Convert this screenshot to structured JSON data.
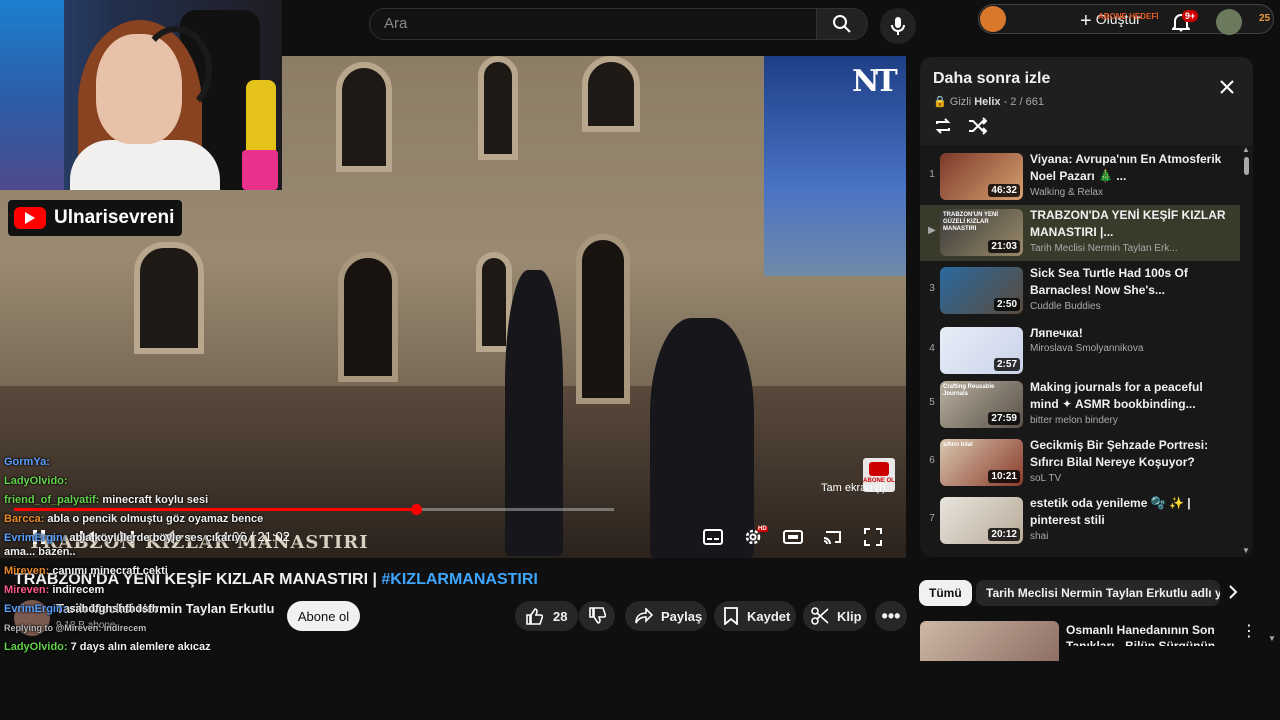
{
  "search": {
    "placeholder": "Ara"
  },
  "topbar": {
    "subscriber_goal": "ABONE HEDEFİ",
    "create_label": "Oluştur",
    "notification_count": "9+",
    "corner_number": "25"
  },
  "player": {
    "time_display": "14:06 / 21:02",
    "progress_fraction": 0.67,
    "fullscreen_tooltip": "Tam ekran (f)",
    "caption_overlay": "TRABZON KIZLAR MANASTIRI",
    "watermark": "NT",
    "abone_badge": "ABONE OL",
    "hd_badge": "HD"
  },
  "webcam": {
    "channel_name": "Ulnarisevreni"
  },
  "chat": [
    {
      "name": "GormYa:",
      "text": "",
      "color": "n-blue"
    },
    {
      "name": "LadyOlvido:",
      "text": "",
      "color": "n-green"
    },
    {
      "name": "friend_of_palyatif:",
      "text": "minecraft koylu sesi",
      "color": "n-green"
    },
    {
      "name": "Barcca:",
      "text": "abla o pencik olmuştu göz oyamaz bence",
      "color": "n-orange"
    },
    {
      "name": "EvrimErgin:",
      "text": "abla köylülerde böyle ses çıkarıyo ama... bazen..",
      "color": "n-blue"
    },
    {
      "name": "Mireven:",
      "text": "canımı minecraft çekti",
      "color": "n-orange"
    },
    {
      "name": "Mireven:",
      "text": "indirecem",
      "color": "n-pink"
    },
    {
      "name": "EvrimErgin:",
      "text": "sahdfghshfhdsfh",
      "color": "n-blue"
    },
    {
      "name": "",
      "text": "Replying to @Mireven: indirecem",
      "color": "reply"
    },
    {
      "name": "LadyOlvido:",
      "text": "7 days alın alemlere akıcaz",
      "color": "n-green"
    }
  ],
  "video": {
    "title_prefix": "TRABZON'DA YENİ KEŞİF KIZLAR MANASTIRI | ",
    "title_tag": "#KIZLARMANASTIRI",
    "channel": "Tarih Meclisi Nermin Taylan Erkutlu",
    "subscribers": "9,18 B abone",
    "subscribe_label": "Abone ol",
    "likes": "28",
    "share_label": "Paylaş",
    "save_label": "Kaydet",
    "clip_label": "Klip"
  },
  "playlist": {
    "title": "Daha sonra izle",
    "privacy": "Gizli",
    "owner": "Helix",
    "position": "2 / 661",
    "items": [
      {
        "index": "1",
        "title": "Viyana: Avrupa'nın En Atmosferik Noel Pazarı 🎄 ...",
        "channel": "Walking & Relax",
        "duration": "46:32",
        "thumb_a": "#7a3a2a",
        "thumb_b": "#d8a070"
      },
      {
        "index": "▶",
        "title": "TRABZON'DA YENİ KEŞİF KIZLAR MANASTIRI |...",
        "channel": "Tarih Meclisi Nermin Taylan Erk...",
        "duration": "21:03",
        "thumb_a": "#3a3a3a",
        "thumb_b": "#9a8a6a",
        "thumb_text": "TRABZON'UN YENİ GÜZELİ KIZLAR MANASTIRI"
      },
      {
        "index": "3",
        "title": "Sick Sea Turtle Had 100s Of Barnacles! Now She's...",
        "channel": "Cuddle Buddies",
        "duration": "2:50",
        "thumb_a": "#2a6aa0",
        "thumb_b": "#5a4a3a"
      },
      {
        "index": "4",
        "title": "Ляпечка!",
        "channel": "Miroslava Smolyannikova",
        "duration": "2:57",
        "thumb_a": "#e8eef8",
        "thumb_b": "#c8d2e8"
      },
      {
        "index": "5",
        "title": "Making journals for a peaceful mind ✦ ASMR bookbinding...",
        "channel": "bitter melon bindery",
        "duration": "27:59",
        "thumb_a": "#b8b0a0",
        "thumb_b": "#5a5048",
        "thumb_text": "Crafting Reusable Journals"
      },
      {
        "index": "6",
        "title": "Gecikmiş Bir Şehzade Portresi: Sıfırcı Bilal Nereye Koşuyor?",
        "channel": "soL TV",
        "duration": "10:21",
        "thumb_a": "#d8c8b0",
        "thumb_b": "#8a3a2a",
        "thumb_text": "sıfırcı bilal"
      },
      {
        "index": "7",
        "title": "estetik oda yenileme 🫧 ✨ | pinterest stili",
        "channel": "shai",
        "duration": "20:12",
        "thumb_a": "#e8e4dc",
        "thumb_b": "#b8aa98"
      }
    ]
  },
  "recommendations": {
    "chips": [
      "Tümü",
      "Tarih Meclisi Nermin Taylan Erkutlu adlı yü"
    ],
    "first_title": "Osmanlı Hanedanının Son Tanıkları - Bilün Sürgünün Son"
  }
}
